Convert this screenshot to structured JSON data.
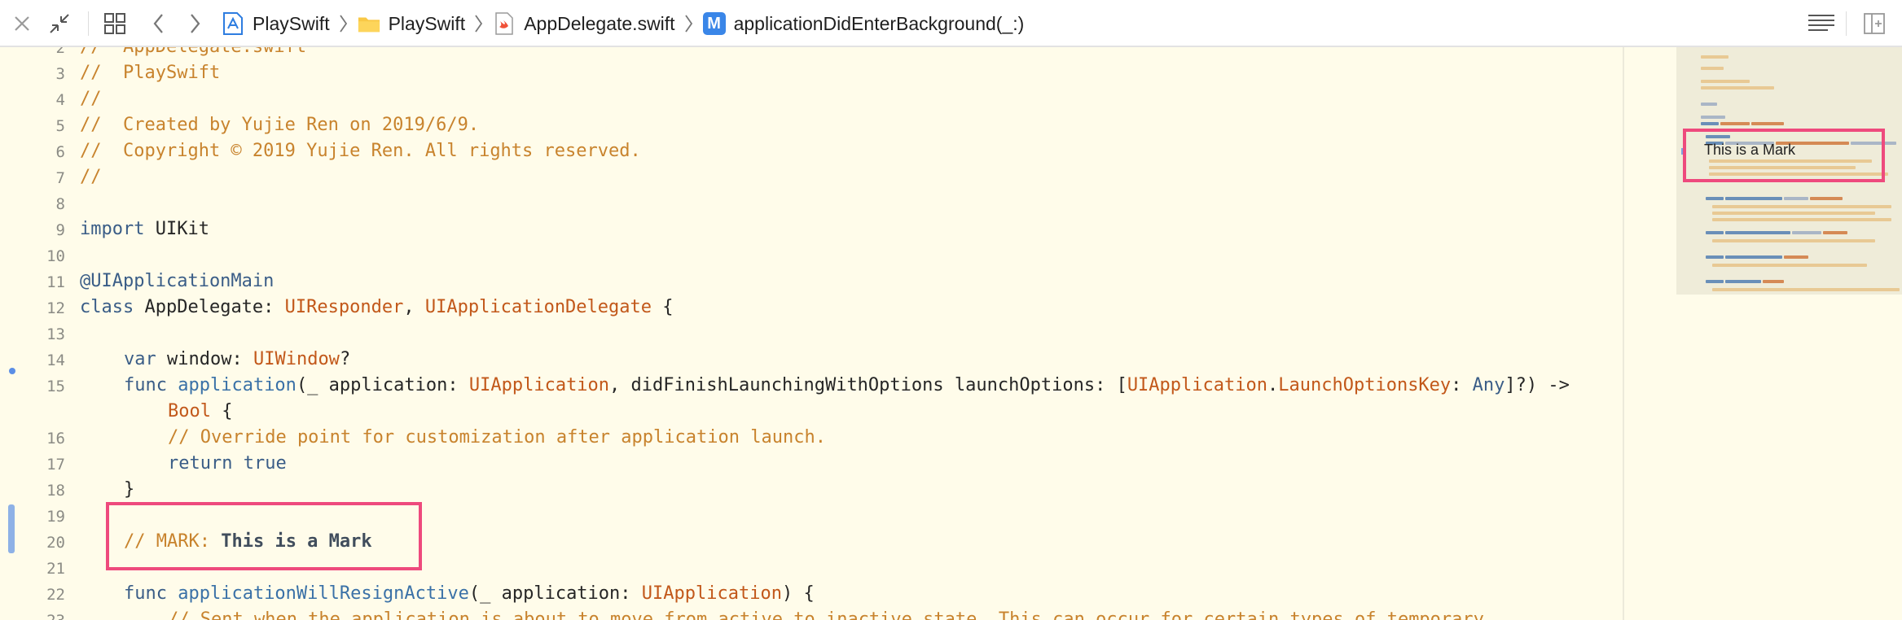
{
  "toolbar": {
    "breadcrumb": [
      {
        "label": "PlaySwift",
        "icon": "project-icon"
      },
      {
        "label": "PlaySwift",
        "icon": "folder-icon"
      },
      {
        "label": "AppDelegate.swift",
        "icon": "swift-file-icon"
      },
      {
        "label": "applicationDidEnterBackground(_:)",
        "icon": "method-icon"
      }
    ],
    "method_badge": "M"
  },
  "editor": {
    "line_numbers": [
      "2",
      "3",
      "4",
      "5",
      "6",
      "7",
      "8",
      "9",
      "10",
      "11",
      "12",
      "13",
      "14",
      "15",
      "16",
      "17",
      "18",
      "19",
      "20",
      "21",
      "22",
      "23"
    ],
    "lines": {
      "l2": "//  AppDelegate.swift",
      "l3": "//  PlaySwift",
      "l4": "//",
      "l5": "//  Created by Yujie Ren on 2019/6/9.",
      "l6": "//  Copyright © 2019 Yujie Ren. All rights reserved.",
      "l7": "//",
      "l9_kw": "import",
      "l9_rest": " UIKit",
      "l11": "@UIApplicationMain",
      "l12_kw": "class",
      "l12_a": " AppDelegate: ",
      "l12_t1": "UIResponder",
      "l12_b": ", ",
      "l12_t2": "UIApplicationDelegate",
      "l12_c": " {",
      "l14_kw": "var",
      "l14_a": " window: ",
      "l14_t": "UIWindow",
      "l14_b": "?",
      "l15_kw": "func",
      "l15_f": " application",
      "l15_a": "(_ application: ",
      "l15_t1": "UIApplication",
      "l15_b": ", didFinishLaunchingWithOptions launchOptions: [",
      "l15_t2": "UIApplication",
      "l15_c": ".",
      "l15_t3": "LaunchOptionsKey",
      "l15_d": ": ",
      "l15_t4": "Any",
      "l15_e": "]?) ->",
      "l15w_t": "Bool",
      "l15w_a": " {",
      "l16": "// Override point for customization after application launch.",
      "l17_kw": "return",
      "l17_rest": " true",
      "l18": "}",
      "l20_c": "// MARK: ",
      "l20_b": "This is a Mark",
      "l22_kw": "func",
      "l22_f": " applicationWillResignActive",
      "l22_a": "(_ application: ",
      "l22_t": "UIApplication",
      "l22_b": ") {",
      "l23": "// Sent when the application is about to move from active to inactive state. This can occur for certain types of temporary"
    }
  },
  "minimap": {
    "mark_label": "This is a Mark"
  },
  "colors": {
    "highlight": "#ee4a7d",
    "comment": "#c8832d",
    "keyword": "#3a5d87",
    "type": "#c2581a",
    "background": "#fffcea"
  }
}
